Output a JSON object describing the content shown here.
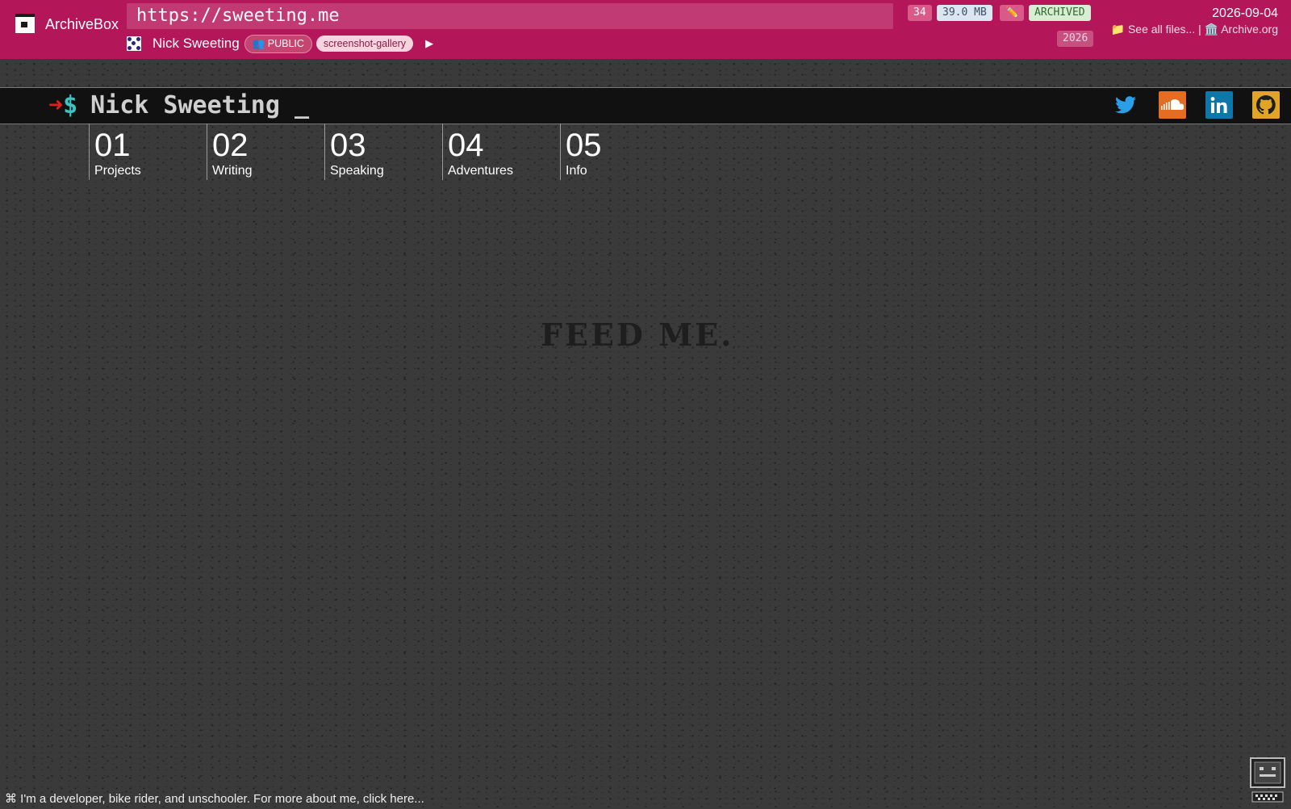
{
  "archivebox": {
    "brand": "ArchiveBox",
    "url": "https://sweeting.me",
    "snapshot_title": "Nick Sweeting",
    "tags": [
      "👥 PUBLIC",
      "screenshot-gallery"
    ],
    "play_label": "▶",
    "file_count": "34",
    "size": "39.0 MB",
    "edit_icon": "✏️",
    "status": "ARCHIVED",
    "year": "2026",
    "date": "2026-09-04",
    "see_all_files": "📁 See all files...",
    "separator": " | ",
    "archive_org": "🏛️ Archive.org"
  },
  "site": {
    "prompt_arrow": "➜",
    "prompt_dollar": "$",
    "name": "Nick Sweeting",
    "cursor": "_",
    "social": [
      "twitter-icon",
      "soundcloud-icon",
      "linkedin-icon",
      "github-icon"
    ],
    "nav": [
      {
        "num": "01",
        "label": "Projects"
      },
      {
        "num": "02",
        "label": "Writing"
      },
      {
        "num": "03",
        "label": "Speaking"
      },
      {
        "num": "04",
        "label": "Adventures"
      },
      {
        "num": "05",
        "label": "Info"
      }
    ],
    "background_text": "FEED ME.",
    "footer": "⌘ I'm a developer, bike rider, and unschooler. For more about me, click here..."
  },
  "colors": {
    "header": "#b3175a",
    "background": "#3a3a3a",
    "terminal": "#111111"
  }
}
